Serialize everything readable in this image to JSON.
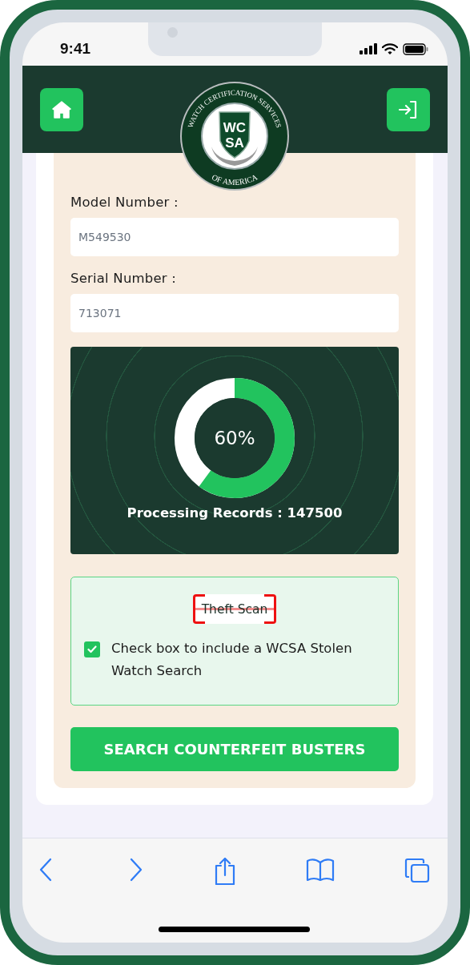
{
  "status_bar": {
    "time": "9:41"
  },
  "header": {
    "logo": {
      "arc_top": "WATCH CERTIFICATION SERVICES",
      "arc_bottom": "OF AMERICA",
      "initials_top": "WC",
      "initials_bottom": "SA"
    }
  },
  "fields": [
    {
      "label": "Model Number :",
      "value": "M549530"
    },
    {
      "label": "Serial Number :",
      "value": "713071"
    }
  ],
  "progress": {
    "level": 0.6,
    "percent": "60%",
    "caption": "Processing Records : 147500"
  },
  "theft_scan": {
    "badge": "Theft Scan",
    "checkbox": {
      "checked": true,
      "label": "Check box to include a WCSA Stolen Watch Search"
    }
  },
  "search_button": "SEARCH COUNTERFEIT BUSTERS"
}
